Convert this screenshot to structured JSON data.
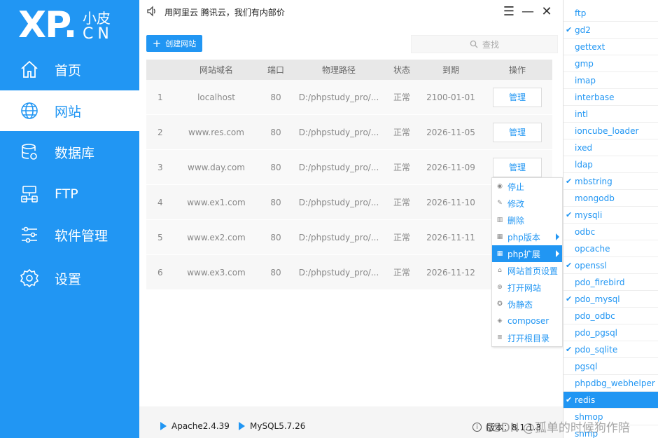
{
  "logo": {
    "main": "XP.",
    "top": "小皮",
    "bottom": "CN"
  },
  "nav": [
    {
      "label": "首页",
      "icon": "home-icon"
    },
    {
      "label": "网站",
      "icon": "globe-icon",
      "active": true
    },
    {
      "label": "数据库",
      "icon": "database-icon"
    },
    {
      "label": "FTP",
      "icon": "server-icon"
    },
    {
      "label": "软件管理",
      "icon": "sliders-icon"
    },
    {
      "label": "设置",
      "icon": "gear-icon"
    }
  ],
  "topbar": {
    "notice": "用阿里云 腾讯云，我们有内部价",
    "menu_glyph": "☰",
    "minimize_glyph": "—",
    "close_glyph": "✕"
  },
  "toolbar": {
    "create_label": "创建网站",
    "search_placeholder": "查找"
  },
  "table": {
    "headers": [
      "",
      "网站域名",
      "端口",
      "物理路径",
      "状态",
      "到期",
      "操作"
    ],
    "rows": [
      {
        "no": "1",
        "domain": "localhost",
        "port": "80",
        "path": "D:/phpstudy_pro/...",
        "status": "正常",
        "expire": "2100-01-01",
        "action": "管理"
      },
      {
        "no": "2",
        "domain": "www.res.com",
        "port": "80",
        "path": "D:/phpstudy_pro/...",
        "status": "正常",
        "expire": "2026-11-05",
        "action": "管理"
      },
      {
        "no": "3",
        "domain": "www.day.com",
        "port": "80",
        "path": "D:/phpstudy_pro/...",
        "status": "正常",
        "expire": "2026-11-09",
        "action": "管理"
      },
      {
        "no": "4",
        "domain": "www.ex1.com",
        "port": "80",
        "path": "D:/phpstudy_pro/...",
        "status": "正常",
        "expire": "2026-11-10",
        "action": ""
      },
      {
        "no": "5",
        "domain": "www.ex2.com",
        "port": "80",
        "path": "D:/phpstudy_pro/...",
        "status": "正常",
        "expire": "2026-11-11",
        "action": ""
      },
      {
        "no": "6",
        "domain": "www.ex3.com",
        "port": "80",
        "path": "D:/phpstudy_pro/...",
        "status": "正常",
        "expire": "2026-11-12",
        "action": ""
      }
    ]
  },
  "context_menu": [
    {
      "label": "停止",
      "icon": "stop-icon",
      "glyph": "◉"
    },
    {
      "label": "修改",
      "icon": "edit-icon",
      "glyph": "✎"
    },
    {
      "label": "删除",
      "icon": "trash-icon",
      "glyph": "▥"
    },
    {
      "label": "php版本",
      "icon": "php-icon",
      "glyph": "▦",
      "submenu": true
    },
    {
      "label": "php扩展",
      "icon": "php-ext-icon",
      "glyph": "▦",
      "submenu": true,
      "highlighted": true
    },
    {
      "label": "网站首页设置",
      "icon": "home-small-icon",
      "glyph": "⌂"
    },
    {
      "label": "打开网站",
      "icon": "globe-small-icon",
      "glyph": "⊕"
    },
    {
      "label": "伪静态",
      "icon": "rewrite-icon",
      "glyph": "✪"
    },
    {
      "label": "composer",
      "icon": "composer-icon",
      "glyph": "◈"
    },
    {
      "label": "打开根目录",
      "icon": "folder-list-icon",
      "glyph": "≣"
    }
  ],
  "extensions": [
    {
      "name": "ftp",
      "checked": false
    },
    {
      "name": "gd2",
      "checked": true
    },
    {
      "name": "gettext",
      "checked": false
    },
    {
      "name": "gmp",
      "checked": false
    },
    {
      "name": "imap",
      "checked": false
    },
    {
      "name": "interbase",
      "checked": false
    },
    {
      "name": "intl",
      "checked": false
    },
    {
      "name": "ioncube_loader",
      "checked": false
    },
    {
      "name": "ixed",
      "checked": false
    },
    {
      "name": "ldap",
      "checked": false
    },
    {
      "name": "mbstring",
      "checked": true
    },
    {
      "name": "mongodb",
      "checked": false
    },
    {
      "name": "mysqli",
      "checked": true
    },
    {
      "name": "odbc",
      "checked": false
    },
    {
      "name": "opcache",
      "checked": false
    },
    {
      "name": "openssl",
      "checked": true
    },
    {
      "name": "pdo_firebird",
      "checked": false
    },
    {
      "name": "pdo_mysql",
      "checked": true
    },
    {
      "name": "pdo_odbc",
      "checked": false
    },
    {
      "name": "pdo_pgsql",
      "checked": false
    },
    {
      "name": "pdo_sqlite",
      "checked": true
    },
    {
      "name": "pgsql",
      "checked": false
    },
    {
      "name": "phpdbg_webhelper",
      "checked": false
    },
    {
      "name": "redis",
      "checked": true,
      "highlighted": true
    },
    {
      "name": "shmop",
      "checked": false
    },
    {
      "name": "snmp",
      "checked": false
    }
  ],
  "statusbar": {
    "services": [
      "Apache2.4.39",
      "MySQL5.7.26"
    ],
    "version_label": "版本：8.1.1.3"
  },
  "watermark": "CSDN @孤单的时候狗作陪",
  "colors": {
    "brand": "#2196f3",
    "sidebar": "#2196f3"
  }
}
